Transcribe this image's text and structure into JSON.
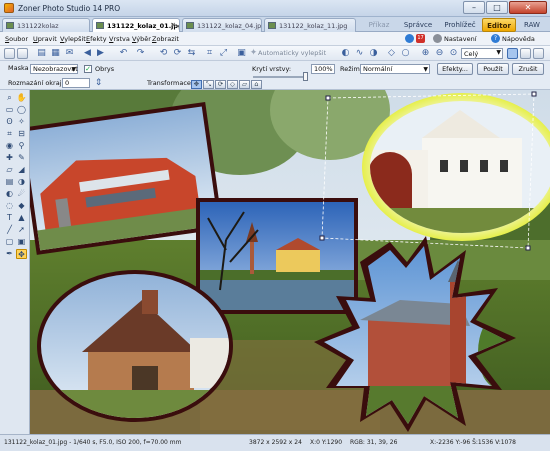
{
  "window": {
    "title": "Zoner Photo Studio 14 PRO",
    "controls": [
      "–",
      "□",
      "✕"
    ]
  },
  "doc_tabs": [
    {
      "label": "131122kolaz",
      "active": false
    },
    {
      "label": "131122_kolaz_01.jpg*",
      "active": true
    },
    {
      "label": "131122_kolaz_04.jpg",
      "active": false
    },
    {
      "label": "131122_kolaz_11.jpg",
      "active": false
    }
  ],
  "mode_tabs": [
    {
      "label": "Příkaz",
      "state": "disabled"
    },
    {
      "label": "Správce",
      "state": "normal"
    },
    {
      "label": "Prohlížeč",
      "state": "normal"
    },
    {
      "label": "Editor",
      "state": "active"
    },
    {
      "label": "RAW",
      "state": "normal"
    }
  ],
  "menu": {
    "items": [
      {
        "first": "S",
        "rest": "oubor"
      },
      {
        "first": "U",
        "rest": "pravit"
      },
      {
        "first": "V",
        "rest": "ylepšit"
      },
      {
        "first": "E",
        "rest": "fekty"
      },
      {
        "first": "V",
        "rest": "rstva"
      },
      {
        "first": "V",
        "rest": "ýběr"
      },
      {
        "first": "Z",
        "rest": "obrazit"
      }
    ],
    "settings": "Nastavení",
    "help": "Nápověda",
    "badge": "17"
  },
  "toolbar": {
    "auto_enhance": "Automaticky vylepšit",
    "zoom": "Celý"
  },
  "options": {
    "mask_label": "Maska",
    "mask_value": "Nezobrazovat",
    "outline_label": "Obrys",
    "outline_checked": "✓",
    "blur_label": "Rozmazání okrajů",
    "blur_value": "0",
    "transform_label": "Transformace",
    "opacity_label": "Krytí vrstvy:",
    "opacity_value": "100%",
    "opacity_level": 100,
    "mode_label": "Režim:",
    "mode_value": "Normální",
    "effects_button": "Efekty...",
    "apply_button": "Použít",
    "cancel_button": "Zrušit"
  },
  "status": {
    "file": "131122_kolaz_01.jpg - 1/640 s, F5.0, ISO 200, f=70.00 mm",
    "dims": "3872 x 2592 x 24",
    "coords": "X:0 Y:1290",
    "rgb": "RGB: 31, 39, 26",
    "zoom": "X:-2236 Y:-96 Š:1536 V:1078"
  },
  "colors": {
    "accent": "#f0a800",
    "frame": "#3a0d0d",
    "selection_glow": "#e6ef4a"
  }
}
